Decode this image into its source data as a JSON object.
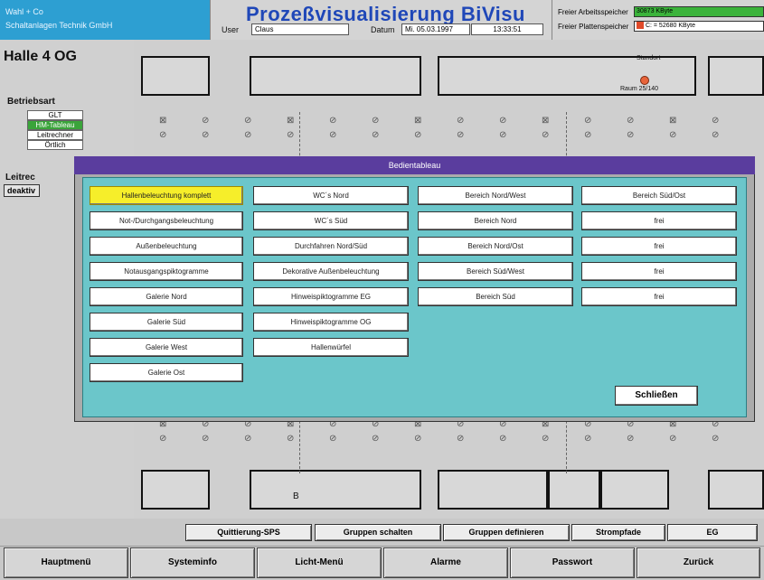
{
  "company": {
    "line1": "Wahl + Co",
    "line2": "Schaltanlagen Technik GmbH"
  },
  "app": {
    "title": "Prozeßvisualisierung  BiVisu"
  },
  "session": {
    "user_label": "User",
    "user_value": "Claus",
    "date_label": "Datum",
    "date_value": "Mi. 05.03.1997",
    "time_value": "13:33:51"
  },
  "memory": {
    "ram_label": "Freier Arbeitsspeicher",
    "ram_value": "30873 KByte",
    "disk_label": "Freier Plattenspeicher",
    "disk_value": "C: = 52680 KByte",
    "ram_color": "#3bb33b",
    "disk_color": "#e04a2a"
  },
  "left_panel": {
    "hall_title": "Halle 4 OG",
    "mode_label": "Betriebsart",
    "modes": [
      "GLT",
      "HM-Tableau",
      "Leitrechner",
      "Örtlich"
    ],
    "active_mode_index": 1,
    "leitrechner_label": "Leitrec",
    "deactivate_label": "deaktiv"
  },
  "plan": {
    "room_label_b": "B",
    "stand_label": "Standort",
    "room_label": "Raum 25/140"
  },
  "modal": {
    "title": "Bedientableau",
    "columns": [
      [
        "Hallenbeleuchtung komplett",
        "Not-/Durchgangsbeleuchtung",
        "Außenbeleuchtung",
        "Notausgangspiktogramme",
        "Galerie Nord",
        "Galerie Süd",
        "Galerie West",
        "Galerie Ost"
      ],
      [
        "WC´s Nord",
        "WC´s Süd",
        "Durchfahren Nord/Süd",
        "Dekorative Außenbeleuchtung",
        "Hinweispiktogramme EG",
        "Hinweispiktogramme OG",
        "Hallenwürfel"
      ],
      [
        "Bereich Nord/West",
        "Bereich Nord",
        "Bereich Nord/Ost",
        "Bereich Süd/West",
        "Bereich Süd"
      ],
      [
        "Bereich Süd/Ost",
        "frei",
        "frei",
        "frei",
        "frei"
      ]
    ],
    "selected_label": "Hallenbeleuchtung komplett",
    "close_label": "Schließen"
  },
  "toolbar1": {
    "buttons": [
      "Quittierung-SPS",
      "Gruppen schalten",
      "Gruppen definieren",
      "Strompfade",
      "EG"
    ]
  },
  "toolbar2": {
    "buttons": [
      "Hauptmenü",
      "Systeminfo",
      "Licht-Menü",
      "Alarme",
      "Passwort",
      "Zurück"
    ]
  }
}
